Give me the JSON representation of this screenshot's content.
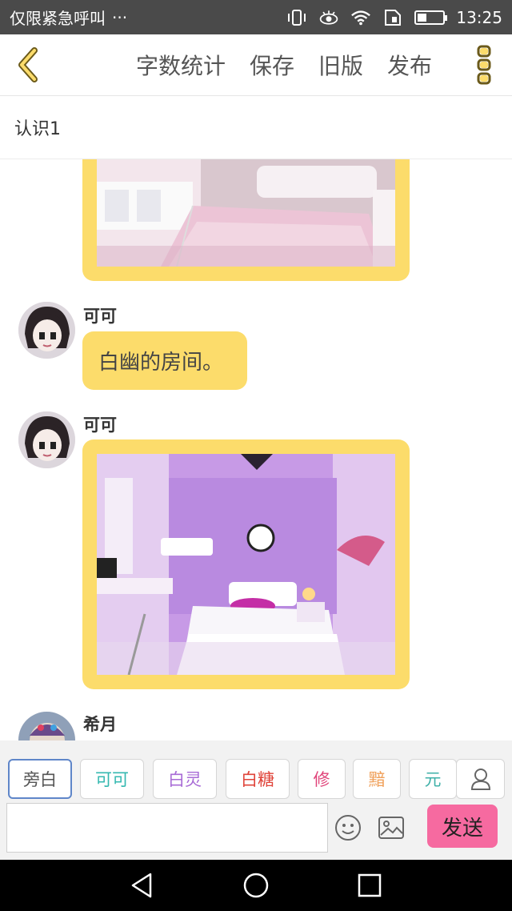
{
  "status_bar": {
    "carrier": "仅限紧急呼叫",
    "more": "···",
    "time": "13:25",
    "battery_level": 0.3,
    "icons": [
      "vibrate-icon",
      "eye-comfort-icon",
      "wifi-icon",
      "sim-icon",
      "battery-icon"
    ]
  },
  "toolbar": {
    "back_icon": "chevron-left-icon",
    "word_count": "字数统计",
    "save": "保存",
    "old_version": "旧版",
    "publish": "发布",
    "more_icon": "more-vertical-icon"
  },
  "chapter": {
    "title": "认识1"
  },
  "messages": [
    {
      "type": "image",
      "image": "pink-bedroom-photo"
    },
    {
      "type": "text",
      "speaker": "可可",
      "text": "白幽的房间。"
    },
    {
      "type": "image",
      "speaker": "可可",
      "image": "purple-bedroom-photo"
    },
    {
      "type": "partial",
      "speaker": "希月"
    }
  ],
  "characters": [
    {
      "label": "旁白",
      "color": "#555555",
      "selected": true
    },
    {
      "label": "可可",
      "color": "#34b8b0",
      "selected": false
    },
    {
      "label": "白灵",
      "color": "#a86bd6",
      "selected": false
    },
    {
      "label": "白糖",
      "color": "#e0443a",
      "selected": false
    },
    {
      "label": "修",
      "color": "#e0447a",
      "selected": false
    },
    {
      "label": "黯",
      "color": "#f0a05a",
      "selected": false
    },
    {
      "label": "元",
      "color": "#3fb0a8",
      "selected": false
    }
  ],
  "input": {
    "placeholder": "",
    "value": "",
    "send": "发送",
    "add_character_icon": "person-icon",
    "emoji_icon": "smile-icon",
    "image_icon": "image-icon"
  },
  "colors": {
    "accent": "#fcdc6b",
    "send": "#f66aa0",
    "status_bar": "#4a4a4a"
  },
  "nav": {
    "icons": [
      "back-triangle-icon",
      "home-circle-icon",
      "recents-square-icon"
    ]
  }
}
